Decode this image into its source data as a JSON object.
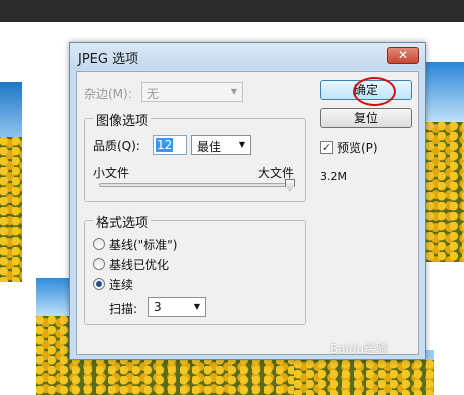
{
  "dialog": {
    "title": "JPEG 选项",
    "close_symbol": "✕"
  },
  "matte": {
    "label": "杂边(M):",
    "value": "无"
  },
  "image_options": {
    "legend": "图像选项",
    "quality_label": "品质(Q):",
    "quality_value": "12",
    "quality_preset": "最佳",
    "small_file_label": "小文件",
    "large_file_label": "大文件",
    "slider_fraction": 1.0
  },
  "format_options": {
    "legend": "格式选项",
    "options": [
      "基线(\"标准\")",
      "基线已优化",
      "连续"
    ],
    "selected": "连续",
    "scans_label": "扫描:",
    "scans_value": "3"
  },
  "buttons": {
    "ok": "确定",
    "reset": "复位"
  },
  "preview": {
    "label": "预览(P)",
    "checked": true,
    "check_mark": "✓"
  },
  "file_size": "3.2M",
  "icons": {
    "dropdown": "▼"
  },
  "watermark": "Baidu经验",
  "colors": {
    "highlight_ring": "#d01010",
    "selection": "#3399ff"
  }
}
